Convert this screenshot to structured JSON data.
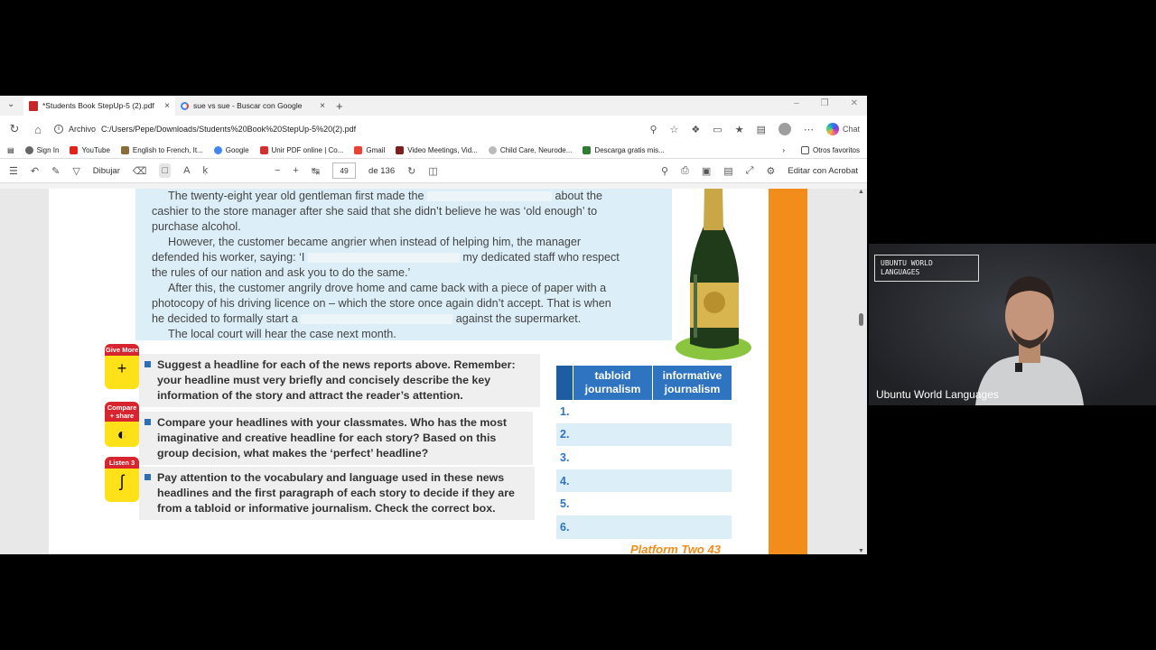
{
  "browser": {
    "tabs": [
      {
        "title": "*Students Book StepUp-5 (2).pdf",
        "active": true
      },
      {
        "title": "sue vs sue - Buscar con Google",
        "active": false
      }
    ],
    "address": {
      "scheme_label": "Archivo",
      "url": "C:/Users/Pepe/Downloads/Students%20Book%20StepUp-5%20(2).pdf"
    },
    "chat_label": "Chat",
    "bookmarks": [
      "Sign In",
      "YouTube",
      "English to French, It...",
      "Google",
      "Unir PDF online | Co...",
      "Gmail",
      "Video Meetings, Vid...",
      "Child Care, Neurode...",
      "Descarga gratis mis..."
    ],
    "other_favorites": "Otros favoritos"
  },
  "pdf_toolbar": {
    "draw_label": "Dibujar",
    "current_page": "49",
    "total_pages": "de 136",
    "edit_acrobat": "Editar con Acrobat"
  },
  "page": {
    "story": {
      "p1a": "The twenty-eight year old gentleman first made the",
      "p1b": "about the",
      "p1c": "cashier to the store manager after she said that she didn’t believe he was ‘old enough’ to",
      "p1d": "purchase alcohol.",
      "p2a": "However, the customer became angrier when instead of helping him, the manager",
      "p2b": "defended his worker, saying: ‘I",
      "p2c": "my dedicated staff who respect",
      "p2d": "the rules of our nation and ask you to do the same.’",
      "p3a": "After this, the customer angrily drove home and came back with a piece of paper with a",
      "p3b": "photocopy of his driving licence on – which the store once again didn’t accept. That is when",
      "p3c": "he decided to formally start a",
      "p3d": "against the supermarket.",
      "p4": "The local court will hear the case next month."
    },
    "tasks": [
      {
        "badge": "Give More",
        "symbol": "+",
        "text": "Suggest a headline for each of the news reports above. Remember: your headline must very briefly and concisely describe the key information of the story and attract the reader’s attention."
      },
      {
        "badge": "Compare + share",
        "symbol": "◐",
        "text": "Compare your headlines with your classmates. Who has the most imaginative and creative headline for each story? Based on this group decision, what makes the ‘perfect’ headline?"
      },
      {
        "badge": "Listen 3",
        "symbol": "ʃ",
        "text": "Pay attention to the vocabulary and language used in these news headlines and the first paragraph of each story to decide if they are from a tabloid or informative journalism. Check the correct box."
      }
    ],
    "table": {
      "headers": [
        "tabloid journalism",
        "informative journalism"
      ],
      "rows": [
        "1.",
        "2.",
        "3.",
        "4.",
        "5.",
        "6."
      ]
    },
    "footer": "Platform Two 43"
  },
  "webcam": {
    "logo": "UBUNTU WORLD LANGUAGES",
    "caption": "Ubuntu World Languages"
  },
  "colors": {
    "accent_blue": "#2f74c0",
    "orange": "#f28c1b",
    "story_bg": "#dceef7"
  }
}
